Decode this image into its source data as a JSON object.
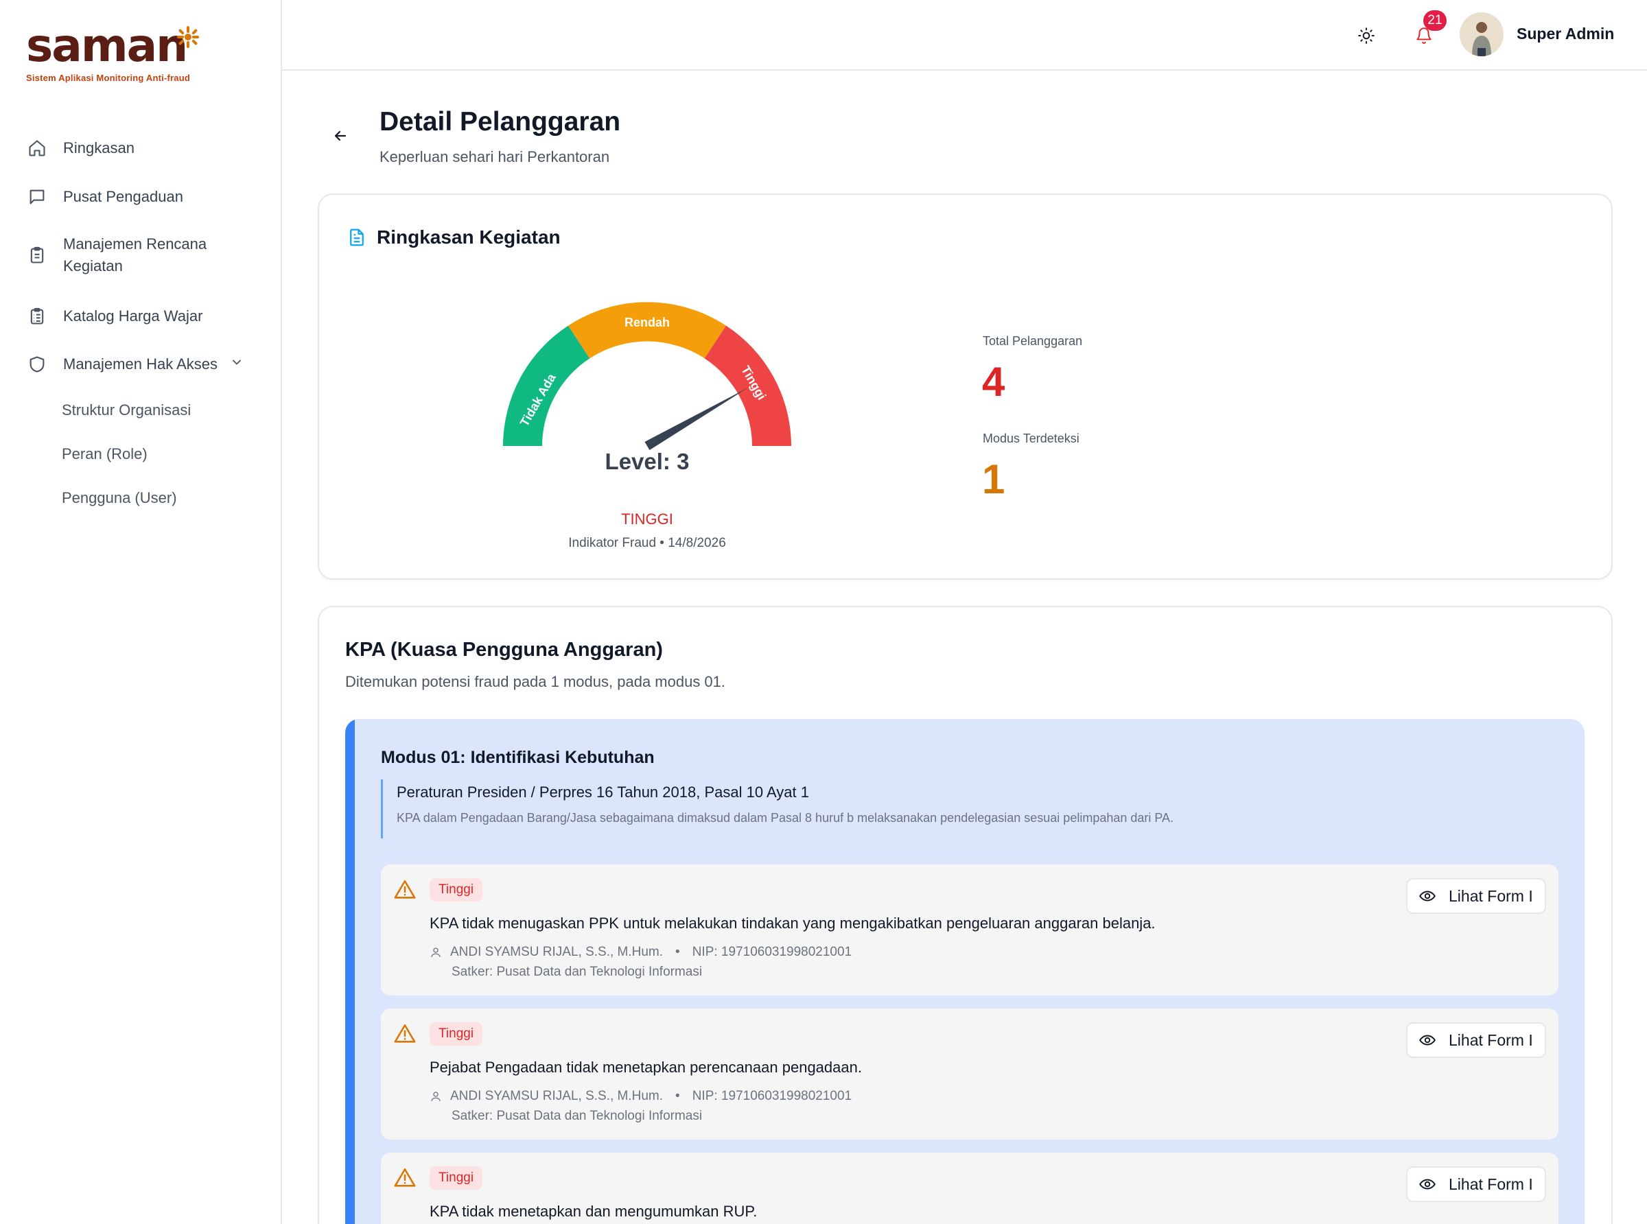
{
  "brand": {
    "name": "saman",
    "tagline": "Sistem Aplikasi Monitoring Anti-fraud"
  },
  "sidebar": {
    "items": [
      {
        "label": "Ringkasan",
        "icon": "home-icon"
      },
      {
        "label": "Pusat Pengaduan",
        "icon": "message-icon"
      },
      {
        "label": "Manajemen Rencana Kegiatan",
        "icon": "clipboard-icon"
      },
      {
        "label": "Katalog Harga Wajar",
        "icon": "clipboard-list-icon"
      },
      {
        "label": "Manajemen Hak Akses",
        "icon": "shield-icon"
      }
    ],
    "subitems": [
      {
        "label": "Struktur Organisasi"
      },
      {
        "label": "Peran (Role)"
      },
      {
        "label": "Pengguna (User)"
      }
    ]
  },
  "header": {
    "notifications_count": "21",
    "user_name": "Super Admin"
  },
  "page": {
    "title": "Detail Pelanggaran",
    "subtitle": "Keperluan sehari hari Perkantoran"
  },
  "summary": {
    "title": "Ringkasan Kegiatan",
    "gauge": {
      "segments": [
        "Tidak Ada",
        "Rendah",
        "Tinggi"
      ],
      "level_text": "Level: 3",
      "level_value": 3,
      "status": "TINGGI",
      "caption": "Indikator Fraud • 14/8/2026",
      "colors": {
        "tidak_ada": "#10b981",
        "rendah": "#f59e0b",
        "tinggi": "#ef4444"
      }
    },
    "stats": [
      {
        "label": "Total Pelanggaran",
        "value": "4",
        "color": "#dc2626"
      },
      {
        "label": "Modus Terdeteksi",
        "value": "1",
        "color": "#d97706"
      }
    ]
  },
  "kpa": {
    "title": "KPA (Kuasa Pengguna Anggaran)",
    "subtitle": "Ditemukan potensi fraud pada 1 modus, pada modus 01.",
    "modus": {
      "title": "Modus 01: Identifikasi Kebutuhan",
      "regulation_title": "Peraturan Presiden / Perpres 16 Tahun 2018, Pasal 10 Ayat 1",
      "regulation_desc": "KPA dalam Pengadaan Barang/Jasa sebagaimana dimaksud dalam Pasal 8 huruf b melaksanakan pendelegasian sesuai pelimpahan dari PA.",
      "findings": [
        {
          "severity": "Tinggi",
          "text": "KPA tidak menugaskan PPK untuk melakukan tindakan yang mengakibatkan pengeluaran anggaran belanja.",
          "person": "ANDI SYAMSU RIJAL, S.S., M.Hum.",
          "nip": "NIP: 197106031998021001",
          "satker": "Satker: Pusat Data dan Teknologi Informasi",
          "button": "Lihat Form I"
        },
        {
          "severity": "Tinggi",
          "text": "Pejabat Pengadaan tidak menetapkan perencanaan pengadaan.",
          "person": "ANDI SYAMSU RIJAL, S.S., M.Hum.",
          "nip": "NIP: 197106031998021001",
          "satker": "Satker: Pusat Data dan Teknologi Informasi",
          "button": "Lihat Form I"
        },
        {
          "severity": "Tinggi",
          "text": "KPA tidak menetapkan dan mengumumkan RUP.",
          "person": "",
          "nip": "",
          "satker": "",
          "button": "Lihat Form I"
        }
      ]
    }
  }
}
